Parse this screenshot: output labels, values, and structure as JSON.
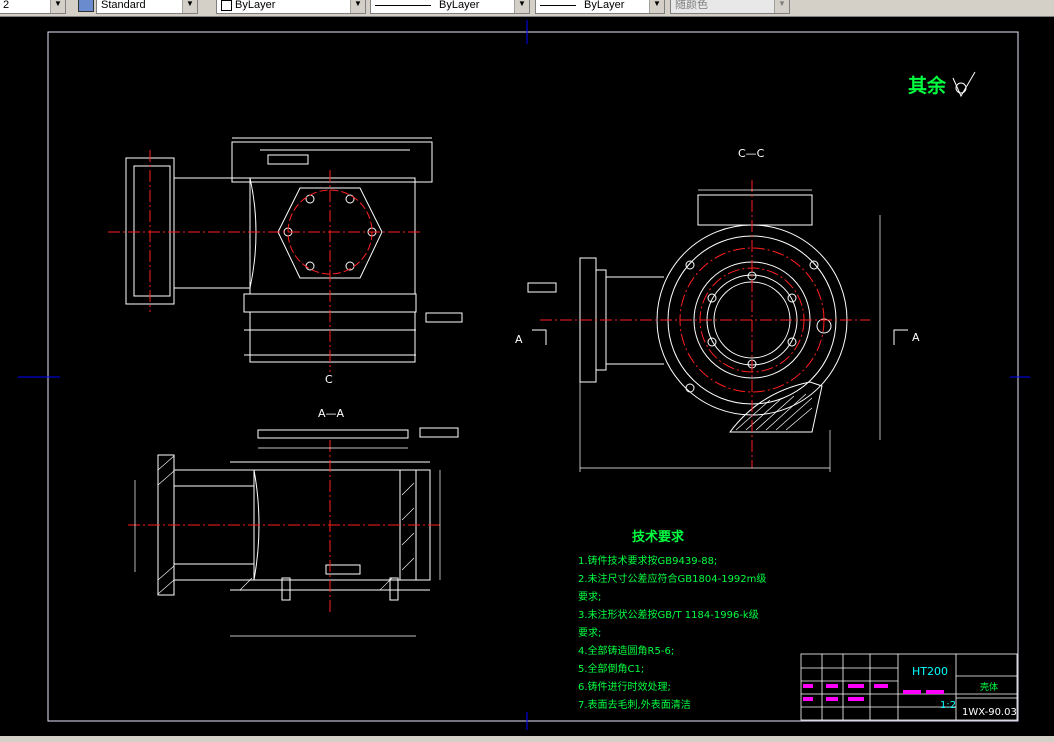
{
  "toolbar": {
    "left_partial": "2",
    "text_style": "Standard",
    "layer": "ByLayer",
    "linetype": "ByLayer",
    "lineweight": "ByLayer",
    "color": "随颜色"
  },
  "drawing": {
    "surface_note": "其余",
    "section_cc": "C—C",
    "section_aa": "A—A",
    "cut_a_left": "A",
    "cut_a_right": "A",
    "cut_c": "C",
    "tech_title": "技术要求",
    "tech_items": [
      "1.铸件技术要求按GB9439-88;",
      "2.未注尺寸公差应符合GB1804-1992m级",
      "要求;",
      "3.未注形状公差按GB/T 1184-1996-k级",
      "要求;",
      "4.全部铸造圆角R5-6;",
      "5.全部倒角C1;",
      "6.铸件进行时效处理;",
      "7.表面去毛刺,外表面清洁"
    ],
    "title_block": {
      "material": "HT200",
      "part_name": "壳体",
      "scale": "1:2",
      "drawing_no": "1WX-90.03"
    }
  },
  "colors": {
    "background": "#000000",
    "lines": "#ffffff",
    "center_lines": "#ff2020",
    "text_green": "#00ff40",
    "cyan": "#00ffff",
    "magenta": "#ff00ff",
    "frame_blue": "#0000ff"
  }
}
